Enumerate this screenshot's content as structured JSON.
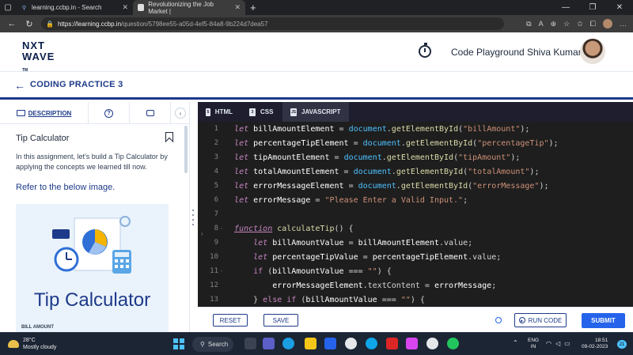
{
  "browser": {
    "tabs": [
      {
        "title": "learning.ccbp.in - Search",
        "icon": "search-icon",
        "active": false
      },
      {
        "title": "Revolutionizing the Job Market |",
        "icon": "page-icon",
        "active": true
      }
    ],
    "url_host": "https://learning.ccbp.in",
    "url_path": "/question/5798ee55-a05d-4ef5-84a8-9b224d7dea57"
  },
  "header": {
    "logo_line1": "NXT",
    "logo_line2": "WAVE",
    "logo_tm": "TM",
    "code_playground": "Code Playground",
    "user_name": "Shiva Kumar"
  },
  "page": {
    "title": "CODING PRACTICE 3"
  },
  "left_panel": {
    "description_tab": "DESCRIPTION",
    "help_icon_char": "?",
    "collapse_char": "‹",
    "question_title": "Tip Calculator",
    "description": "In this assignment, let's build a Tip Calculator by applying the concepts we learned till now.",
    "refer": "Refer to the below image.",
    "preview_title": "Tip Calculator",
    "preview_label": "BILL AMOUNT"
  },
  "editor": {
    "tabs": [
      {
        "label": "HTML",
        "icon": "html5-icon",
        "active": false
      },
      {
        "label": "CSS",
        "icon": "css3-icon",
        "active": false
      },
      {
        "label": "JAVASCRIPT",
        "icon": "js-file-icon",
        "active": true
      }
    ],
    "line_numbers": [
      "1",
      "2",
      "3",
      "4",
      "5",
      "6",
      "7",
      "8",
      "9",
      "10",
      "11",
      "12",
      "13"
    ],
    "fold_markers": [
      "",
      "",
      "",
      "",
      "",
      "",
      "",
      "-",
      "",
      "",
      "-",
      "",
      ""
    ],
    "right_arrow": "›"
  },
  "toolbar": {
    "reset": "RESET",
    "save": "SAVE",
    "run_code": "RUN CODE",
    "submit": "SUBMIT"
  },
  "taskbar": {
    "temp": "28°C",
    "weather": "Mostly cloudy",
    "search": "Search",
    "lang1": "ENG",
    "lang2": "IN",
    "time": "18:51",
    "date": "09-02-2023",
    "notifications": "21"
  },
  "colors": {
    "brand": "#1e3a8a",
    "accent": "#2563eb",
    "editor_bg": "#1e1e1e"
  }
}
